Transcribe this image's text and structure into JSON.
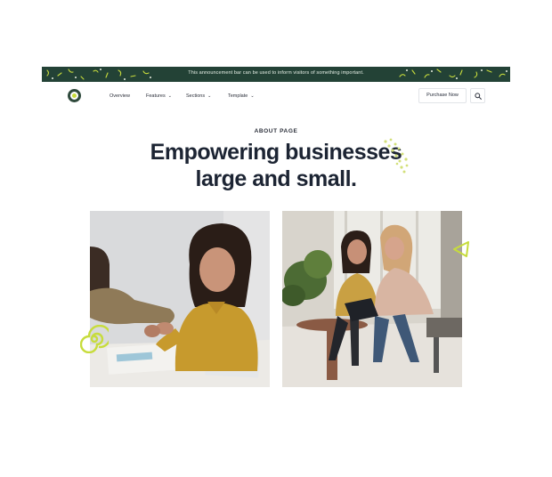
{
  "announcement": {
    "text": "This announcement bar can be used to inform visitors of something important."
  },
  "nav": {
    "items": [
      {
        "label": "Overview",
        "has_dropdown": false
      },
      {
        "label": "Features",
        "has_dropdown": true
      },
      {
        "label": "Sections",
        "has_dropdown": true
      },
      {
        "label": "Template",
        "has_dropdown": true
      }
    ],
    "purchase_label": "Purchase Now",
    "search_icon": "search-icon",
    "dropdown_icon": "chevron-down-icon"
  },
  "hero": {
    "eyebrow": "ABOUT PAGE",
    "headline_line1": "Empowering businesses",
    "headline_line2": "large and small."
  },
  "colors": {
    "announcement_bg": "#234236",
    "accent": "#c7dc3c",
    "heading": "#1c2433"
  },
  "images": [
    {
      "name": "handshake-photo"
    },
    {
      "name": "meeting-photo"
    }
  ]
}
